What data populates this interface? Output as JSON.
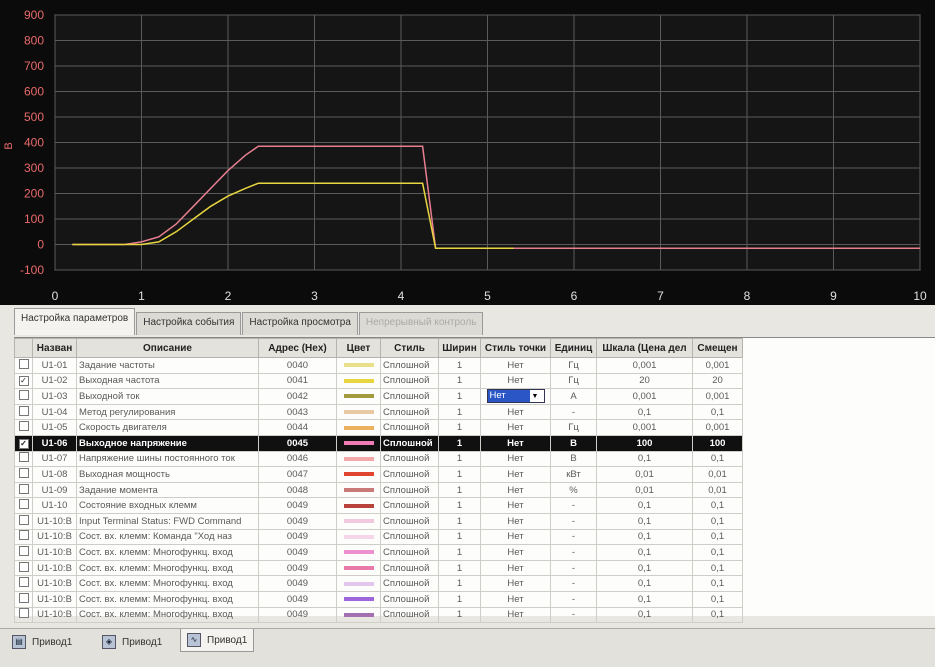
{
  "chart_data": {
    "type": "line",
    "ylabel": "В",
    "xlim": [
      0,
      10
    ],
    "ylim": [
      -100,
      900
    ],
    "xticks": [
      "0",
      "1",
      "2",
      "3",
      "4",
      "5",
      "6",
      "7",
      "8",
      "9",
      "10"
    ],
    "yticks": [
      "900",
      "800",
      "700",
      "600",
      "500",
      "400",
      "300",
      "200",
      "100",
      "0",
      "-100"
    ],
    "grid": true,
    "series": [
      {
        "color": "#e87f90",
        "points": [
          [
            0.2,
            0
          ],
          [
            0.8,
            0
          ],
          [
            1.0,
            10
          ],
          [
            1.2,
            30
          ],
          [
            1.4,
            80
          ],
          [
            1.6,
            150
          ],
          [
            1.8,
            220
          ],
          [
            2.0,
            290
          ],
          [
            2.2,
            350
          ],
          [
            2.35,
            385
          ],
          [
            4.25,
            385
          ],
          [
            4.4,
            -15
          ],
          [
            10.0,
            -15
          ]
        ]
      },
      {
        "color": "#e8d640",
        "points": [
          [
            0.2,
            0
          ],
          [
            1.0,
            0
          ],
          [
            1.2,
            10
          ],
          [
            1.4,
            50
          ],
          [
            1.6,
            100
          ],
          [
            1.8,
            150
          ],
          [
            2.0,
            190
          ],
          [
            2.2,
            220
          ],
          [
            2.35,
            240
          ],
          [
            4.25,
            240
          ],
          [
            4.4,
            -15
          ],
          [
            5.3,
            -15
          ]
        ]
      }
    ]
  },
  "tabs": {
    "params": "Настройка параметров",
    "event": "Настройка события",
    "view": "Настройка просмотра",
    "continuous": "Непрерывный контроль"
  },
  "table": {
    "headers": [
      "Назван",
      "Описание",
      "Адрес (Hex)",
      "Цвет",
      "Стиль",
      "Ширин",
      "Стиль точки",
      "Единиц",
      "Шкала (Цена дел",
      "Смещен"
    ],
    "rows": [
      {
        "checked": false,
        "selected": false,
        "name": "U1-01",
        "desc": "Задание частоты",
        "addr": "0040",
        "color": "#e9e08a",
        "style": "Сплошной",
        "width": "1",
        "point": "Нет",
        "unit": "Гц",
        "scale": "0,001",
        "offset": "0,001"
      },
      {
        "checked": true,
        "selected": false,
        "name": "U1-02",
        "desc": "Выходная частота",
        "addr": "0041",
        "color": "#e8d640",
        "style": "Сплошной",
        "width": "1",
        "point": "Нет",
        "unit": "Гц",
        "scale": "20",
        "offset": "20"
      },
      {
        "checked": false,
        "selected": false,
        "name": "U1-03",
        "desc": "Выходной ток",
        "addr": "0042",
        "color": "#a29a3c",
        "style": "Сплошной",
        "width": "1",
        "point": "Нет",
        "unit": "А",
        "scale": "0,001",
        "offset": "0,001"
      },
      {
        "checked": false,
        "selected": false,
        "name": "U1-04",
        "desc": "Метод регулирования",
        "addr": "0043",
        "color": "#e9c9a4",
        "style": "Сплошной",
        "width": "1",
        "point": "Нет",
        "unit": "-",
        "scale": "0,1",
        "offset": "0,1"
      },
      {
        "checked": false,
        "selected": false,
        "name": "U1-05",
        "desc": "Скорость двигателя",
        "addr": "0044",
        "color": "#ecb05f",
        "style": "Сплошной",
        "width": "1",
        "point": "Нет",
        "unit": "Гц",
        "scale": "0,001",
        "offset": "0,001"
      },
      {
        "checked": true,
        "selected": true,
        "name": "U1-06",
        "desc": "Выходное напряжение",
        "addr": "0045",
        "color": "#f07bb5",
        "style": "Сплошной",
        "width": "1",
        "point": "Нет",
        "unit": "В",
        "scale": "100",
        "offset": "100"
      },
      {
        "checked": false,
        "selected": false,
        "name": "U1-07",
        "desc": "Напряжение шины постоянного ток",
        "addr": "0046",
        "color": "#f2a8a8",
        "style": "Сплошной",
        "width": "1",
        "point": "Нет",
        "unit": "В",
        "scale": "0,1",
        "offset": "0,1"
      },
      {
        "checked": false,
        "selected": false,
        "name": "U1-08",
        "desc": "Выходная мощность",
        "addr": "0047",
        "color": "#e0452f",
        "style": "Сплошной",
        "width": "1",
        "point": "Нет",
        "unit": "кВт",
        "scale": "0,01",
        "offset": "0,01"
      },
      {
        "checked": false,
        "selected": false,
        "name": "U1-09",
        "desc": "Задание момента",
        "addr": "0048",
        "color": "#c97a78",
        "style": "Сплошной",
        "width": "1",
        "point": "Нет",
        "unit": "%",
        "scale": "0,01",
        "offset": "0,01"
      },
      {
        "checked": false,
        "selected": false,
        "name": "U1-10",
        "desc": "Состояние входных клемм",
        "addr": "0049",
        "color": "#b8433a",
        "style": "Сплошной",
        "width": "1",
        "point": "Нет",
        "unit": "-",
        "scale": "0,1",
        "offset": "0,1"
      },
      {
        "checked": false,
        "selected": false,
        "name": "U1-10:B",
        "desc": "Input Terminal Status: FWD Command",
        "addr": "0049",
        "color": "#f2c8de",
        "style": "Сплошной",
        "width": "1",
        "point": "Нет",
        "unit": "-",
        "scale": "0,1",
        "offset": "0,1"
      },
      {
        "checked": false,
        "selected": false,
        "name": "U1-10:B",
        "desc": "Сост. вх. клемм: Команда \"Ход наз",
        "addr": "0049",
        "color": "#f6d7ea",
        "style": "Сплошной",
        "width": "1",
        "point": "Нет",
        "unit": "-",
        "scale": "0,1",
        "offset": "0,1"
      },
      {
        "checked": false,
        "selected": false,
        "name": "U1-10:B",
        "desc": "Сост. вх. клемм: Многофункц. вход",
        "addr": "0049",
        "color": "#ee8fcf",
        "style": "Сплошной",
        "width": "1",
        "point": "Нет",
        "unit": "-",
        "scale": "0,1",
        "offset": "0,1"
      },
      {
        "checked": false,
        "selected": false,
        "name": "U1-10:B",
        "desc": "Сост. вх. клемм: Многофункц. вход",
        "addr": "0049",
        "color": "#e77aa8",
        "style": "Сплошной",
        "width": "1",
        "point": "Нет",
        "unit": "-",
        "scale": "0,1",
        "offset": "0,1"
      },
      {
        "checked": false,
        "selected": false,
        "name": "U1-10:B",
        "desc": "Сост. вх. клемм: Многофункц. вход",
        "addr": "0049",
        "color": "#e3c6ee",
        "style": "Сплошной",
        "width": "1",
        "point": "Нет",
        "unit": "-",
        "scale": "0,1",
        "offset": "0,1"
      },
      {
        "checked": false,
        "selected": false,
        "name": "U1-10:B",
        "desc": "Сост. вх. клемм: Многофункц. вход",
        "addr": "0049",
        "color": "#9d66dd",
        "style": "Сплошной",
        "width": "1",
        "point": "Нет",
        "unit": "-",
        "scale": "0,1",
        "offset": "0,1"
      },
      {
        "checked": false,
        "selected": false,
        "name": "U1-10:B",
        "desc": "Сост. вх. клемм: Многофункц. вход",
        "addr": "0049",
        "color": "#a36fb0",
        "style": "Сплошной",
        "width": "1",
        "point": "Нет",
        "unit": "-",
        "scale": "0,1",
        "offset": "0,1"
      }
    ]
  },
  "dropdown": {
    "value": "Нет"
  },
  "taskbar": {
    "items": [
      "Привод1",
      "Привод1",
      "Привод1"
    ]
  }
}
